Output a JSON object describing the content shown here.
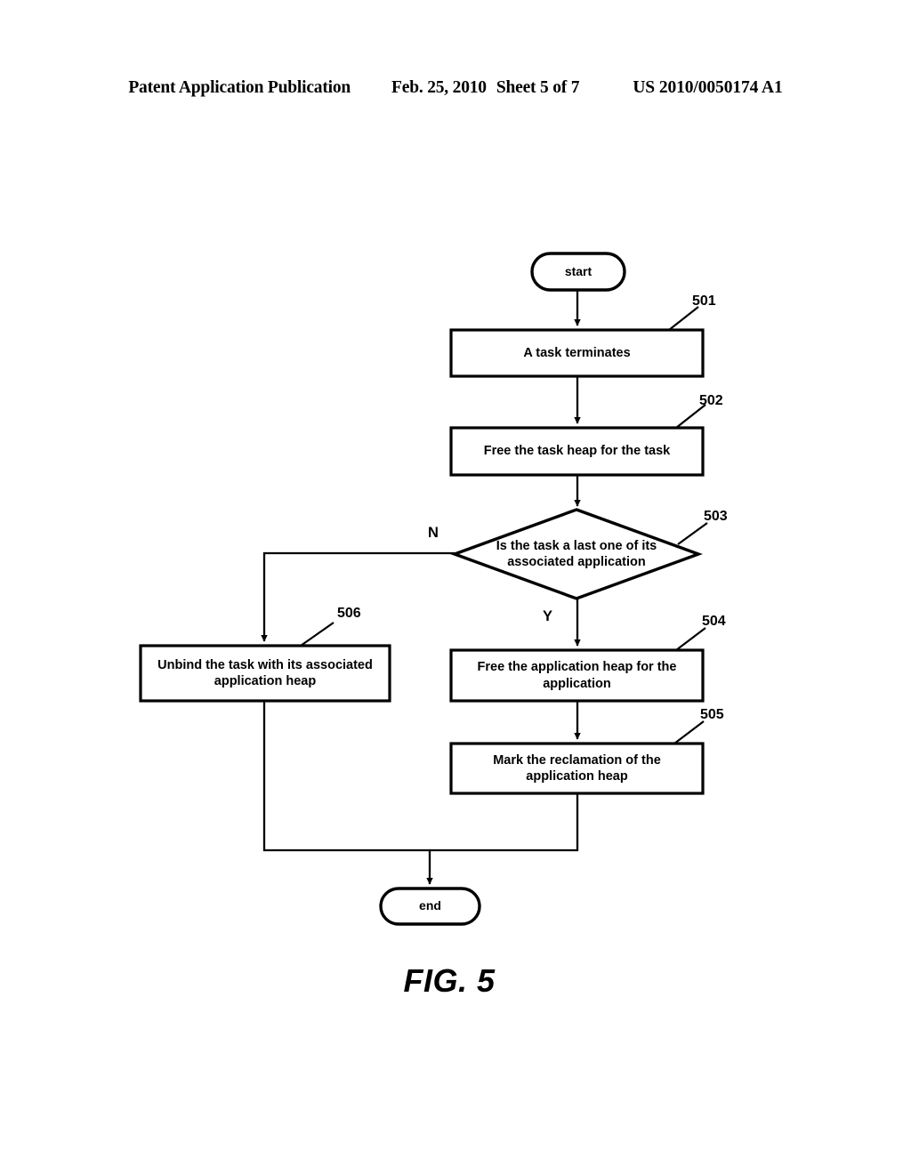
{
  "header": {
    "publication": "Patent Application Publication",
    "date": "Feb. 25, 2010",
    "sheet": "Sheet 5 of 7",
    "patent_number": "US 2010/0050174 A1"
  },
  "figure": {
    "caption": "FIG. 5"
  },
  "flowchart": {
    "type": "flowchart",
    "nodes": [
      {
        "id": "start",
        "shape": "terminator",
        "label": "start",
        "ref": ""
      },
      {
        "id": "n501",
        "shape": "process",
        "label": "A task terminates",
        "ref": "501"
      },
      {
        "id": "n502",
        "shape": "process",
        "label": "Free the task heap for the task",
        "ref": "502"
      },
      {
        "id": "n503",
        "shape": "decision",
        "label": "Is the task a last one of its associated application",
        "ref": "503"
      },
      {
        "id": "n506",
        "shape": "process",
        "label": "Unbind the task with its associated application heap",
        "ref": "506"
      },
      {
        "id": "n504",
        "shape": "process",
        "label": "Free the application heap for the application",
        "ref": "504"
      },
      {
        "id": "n505",
        "shape": "process",
        "label": "Mark the reclamation of the application heap",
        "ref": "505"
      },
      {
        "id": "end",
        "shape": "terminator",
        "label": "end",
        "ref": ""
      }
    ],
    "edges": [
      {
        "from": "start",
        "to": "n501",
        "label": ""
      },
      {
        "from": "n501",
        "to": "n502",
        "label": ""
      },
      {
        "from": "n502",
        "to": "n503",
        "label": ""
      },
      {
        "from": "n503",
        "to": "n506",
        "label": "N"
      },
      {
        "from": "n503",
        "to": "n504",
        "label": "Y"
      },
      {
        "from": "n504",
        "to": "n505",
        "label": ""
      },
      {
        "from": "n505",
        "to": "end",
        "label": ""
      },
      {
        "from": "n506",
        "to": "end",
        "label": ""
      }
    ],
    "branch_labels": {
      "no": "N",
      "yes": "Y"
    },
    "stroke_color": "#000000",
    "fill_color": "#ffffff"
  }
}
